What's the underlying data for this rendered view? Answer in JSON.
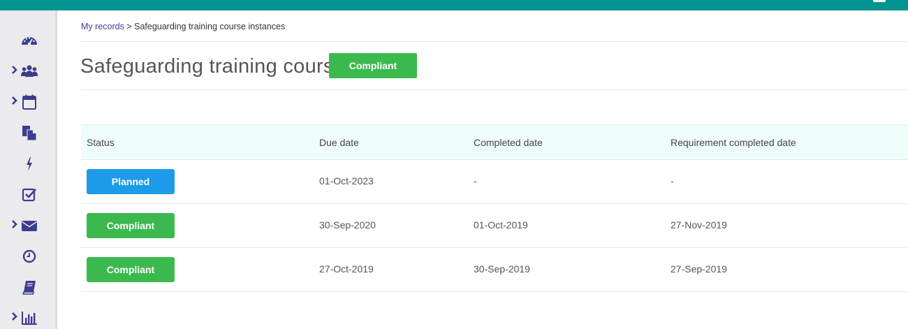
{
  "breadcrumb": {
    "parent": "My records",
    "separator": ">",
    "current": "Safeguarding training course instances"
  },
  "page": {
    "title": "Safeguarding training course",
    "status": "Compliant"
  },
  "table": {
    "headers": [
      "Status",
      "Due date",
      "Completed date",
      "Requirement completed date"
    ],
    "rows": [
      {
        "status": "Planned",
        "due": "01-Oct-2023",
        "completed": "-",
        "req_completed": "-"
      },
      {
        "status": "Compliant",
        "due": "30-Sep-2020",
        "completed": "01-Oct-2019",
        "req_completed": "27-Nov-2019"
      },
      {
        "status": "Compliant",
        "due": "27-Oct-2019",
        "completed": "30-Sep-2019",
        "req_completed": "27-Sep-2019"
      }
    ]
  },
  "sidebar": {
    "items": [
      {
        "icon": "dashboard-icon",
        "expandable": false
      },
      {
        "icon": "users-icon",
        "expandable": true
      },
      {
        "icon": "calendar-icon",
        "expandable": true
      },
      {
        "icon": "documents-icon",
        "expandable": false
      },
      {
        "icon": "lightning-icon",
        "expandable": false
      },
      {
        "icon": "checkbox-icon",
        "expandable": false
      },
      {
        "icon": "envelope-icon",
        "expandable": true
      },
      {
        "icon": "clock-icon",
        "expandable": false
      },
      {
        "icon": "book-icon",
        "expandable": false
      },
      {
        "icon": "bar-chart-icon",
        "expandable": true
      }
    ]
  },
  "colors": {
    "topbar": "#009490",
    "sidebar_icon": "#3d3d8f",
    "compliant": "#3cb94e",
    "planned": "#1e9be8",
    "table_header_bg": "#effdfd"
  }
}
